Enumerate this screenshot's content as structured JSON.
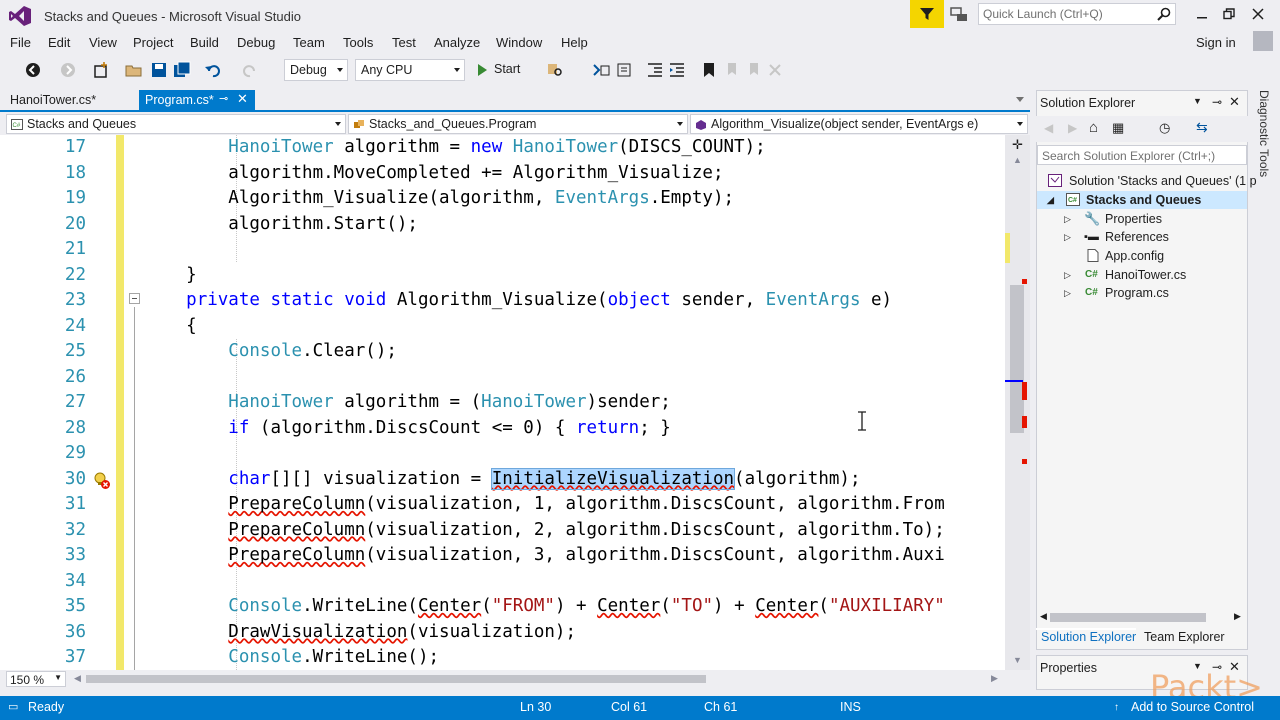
{
  "window": {
    "title": "Stacks and Queues - Microsoft Visual Studio",
    "quick_launch_placeholder": "Quick Launch (Ctrl+Q)",
    "sign_in": "Sign in"
  },
  "menu": [
    "File",
    "Edit",
    "View",
    "Project",
    "Build",
    "Debug",
    "Team",
    "Tools",
    "Test",
    "Analyze",
    "Window",
    "Help"
  ],
  "toolbar": {
    "configuration": "Debug",
    "platform": "Any CPU",
    "start_label": "Start"
  },
  "doc_tabs": [
    {
      "label": "HanoiTower.cs*",
      "active": false
    },
    {
      "label": "Program.cs*",
      "active": true
    }
  ],
  "navbar": {
    "project": "Stacks and Queues",
    "type": "Stacks_and_Queues.Program",
    "member": "Algorithm_Visualize(object sender, EventArgs e)"
  },
  "editor": {
    "line_numbers": [
      "17",
      "18",
      "19",
      "20",
      "21",
      "22",
      "23",
      "24",
      "25",
      "26",
      "27",
      "28",
      "29",
      "30",
      "31",
      "32",
      "33",
      "34",
      "35",
      "36",
      "37"
    ],
    "zoom": "150 %"
  },
  "solution_explorer": {
    "title": "Solution Explorer",
    "search_placeholder": "Search Solution Explorer (Ctrl+;)",
    "items": [
      {
        "label": "Solution 'Stacks and Queues' (1 p",
        "level": 0,
        "icon": "solution-icon"
      },
      {
        "label": "Stacks and Queues",
        "level": 1,
        "icon": "csharp-project-icon",
        "selected": true
      },
      {
        "label": "Properties",
        "level": 2,
        "icon": "wrench-icon"
      },
      {
        "label": "References",
        "level": 2,
        "icon": "references-icon"
      },
      {
        "label": "App.config",
        "level": 2,
        "icon": "config-file-icon"
      },
      {
        "label": "HanoiTower.cs",
        "level": 2,
        "icon": "csharp-file-icon"
      },
      {
        "label": "Program.cs",
        "level": 2,
        "icon": "csharp-file-icon"
      }
    ],
    "tabs": [
      "Solution Explorer",
      "Team Explorer"
    ],
    "properties_title": "Properties"
  },
  "side_tab": "Diagnostic Tools",
  "watermark": "Packt>",
  "statusbar": {
    "state": "Ready",
    "line": "Ln 30",
    "col": "Col 61",
    "ch": "Ch 61",
    "mode": "INS",
    "source_control": "Add to Source Control"
  },
  "colors": {
    "accent": "#007acc",
    "keyword": "#0000ff",
    "type": "#2b91af",
    "string": "#a31515",
    "error": "#e51400"
  }
}
